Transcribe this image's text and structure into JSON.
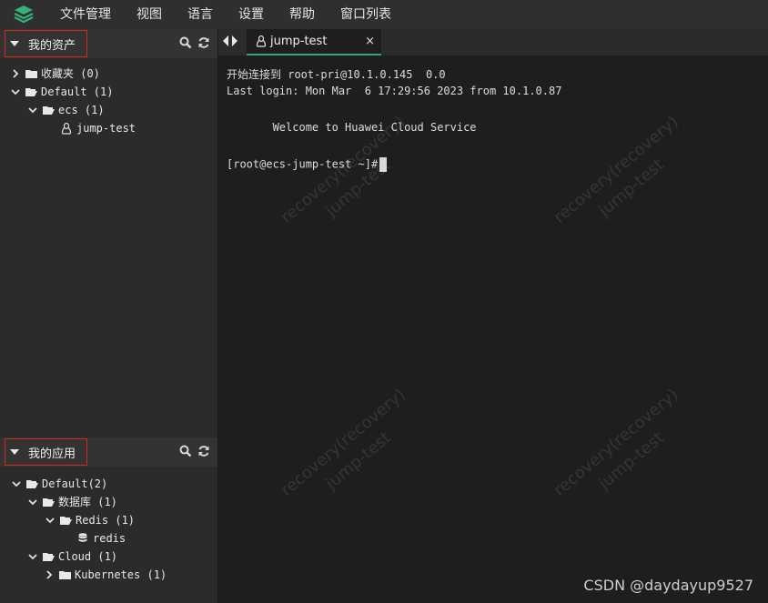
{
  "menubar": {
    "items": [
      "文件管理",
      "视图",
      "语言",
      "设置",
      "帮助",
      "窗口列表"
    ]
  },
  "assets_panel": {
    "title": "我的资产",
    "tree": [
      {
        "label": "收藏夹 (0)"
      },
      {
        "label": "Default (1)"
      },
      {
        "label": "ecs (1)"
      },
      {
        "label": "jump-test"
      }
    ]
  },
  "apps_panel": {
    "title": "我的应用",
    "tree": [
      {
        "label": "Default(2)"
      },
      {
        "label": "数据库 (1)"
      },
      {
        "label": "Redis (1)"
      },
      {
        "label": "redis"
      },
      {
        "label": "Cloud (1)"
      },
      {
        "label": "Kubernetes (1)"
      }
    ]
  },
  "tab": {
    "title": "jump-test",
    "close": "×"
  },
  "terminal": {
    "lines": [
      "开始连接到 root-pri@10.1.0.145  0.0",
      "Last login: Mon Mar  6 17:29:56 2023 from 10.1.0.87",
      "       Welcome to Huawei Cloud Service",
      "[root@ecs-jump-test ~]#"
    ]
  },
  "watermark": {
    "line1": "recovery(recovery)",
    "line2": "jump-test"
  },
  "footer": {
    "credit": "CSDN @daydayup9527"
  },
  "colors": {
    "accent": "#2fa77a",
    "highlight_border": "#d9251d",
    "logo": "#35b07d"
  }
}
